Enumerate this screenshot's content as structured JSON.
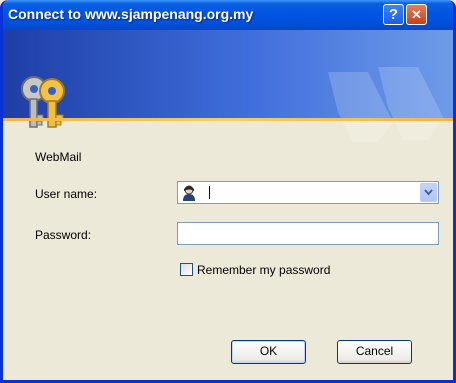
{
  "window": {
    "title": "Connect to www.sjampenang.org.my",
    "help_glyph": "?",
    "close_glyph": "✕"
  },
  "banner": {
    "icon": "keys-icon"
  },
  "form": {
    "realm": "WebMail",
    "username_label": "User name:",
    "username_value": "",
    "password_label": "Password:",
    "password_value": "",
    "remember_label": "Remember my password",
    "remember_checked": false
  },
  "buttons": {
    "ok": "OK",
    "cancel": "Cancel"
  },
  "colors": {
    "title_bar": "#0054e3",
    "dialog_bg": "#ece9d8",
    "banner_accent": "#f8b24a"
  }
}
